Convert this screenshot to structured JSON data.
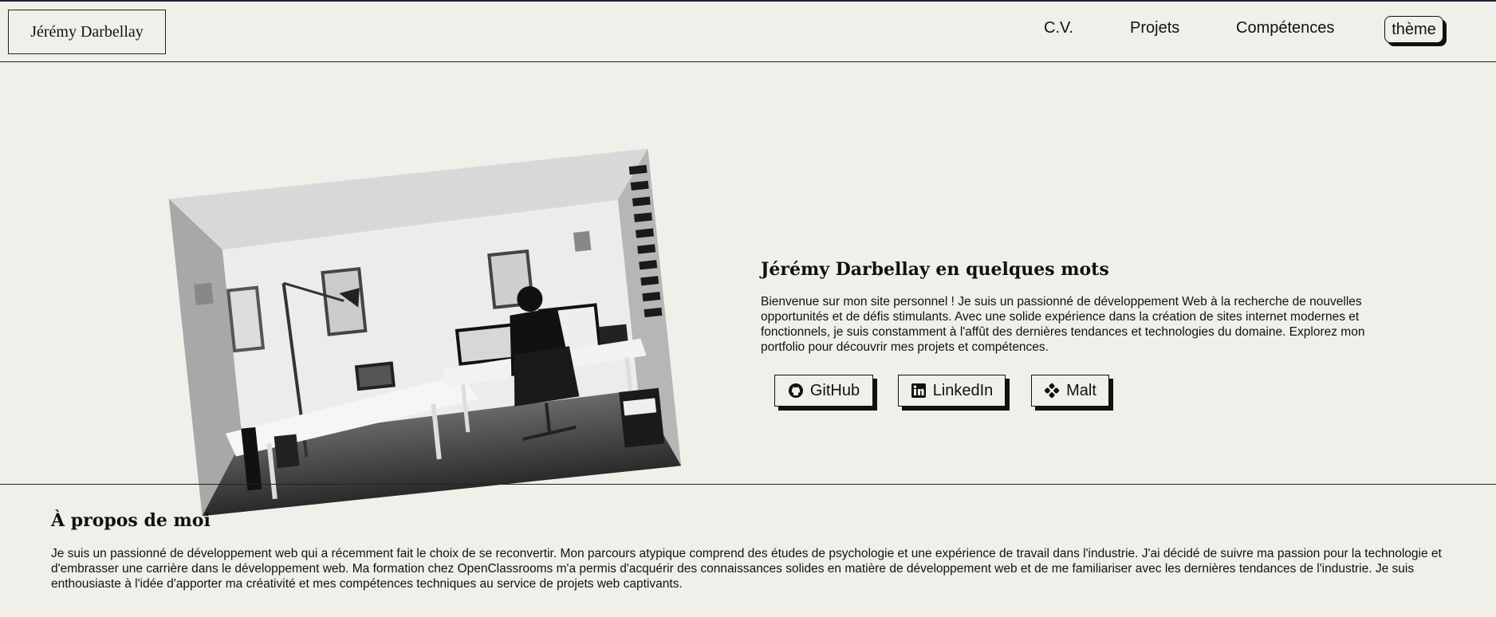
{
  "header": {
    "brand": "Jérémy Darbellay",
    "nav": [
      "C.V.",
      "Projets",
      "Compétences"
    ],
    "theme_label": "thème"
  },
  "hero": {
    "title": "Jérémy Darbellay en quelques mots",
    "text": "Bienvenue sur mon site personnel ! Je suis un passionné de développement Web à la recherche de nouvelles opportunités et de défis stimulants. Avec une solide expérience dans la création de sites internet modernes et fonctionnels, je suis constamment à l'affût des dernières tendances et technologies du domaine. Explorez mon portfolio pour découvrir mes projets et compétences.",
    "links": [
      {
        "label": "GitHub",
        "icon": "github-icon"
      },
      {
        "label": "LinkedIn",
        "icon": "linkedin-icon"
      },
      {
        "label": "Malt",
        "icon": "malt-icon"
      }
    ]
  },
  "about": {
    "title": "À propos de moi",
    "text": "Je suis un passionné de développement web qui a récemment fait le choix de se reconvertir. Mon parcours atypique comprend des études de psychologie et une expérience de travail dans l'industrie. J'ai décidé de suivre ma passion pour la technologie et d'embrasser une carrière dans le développement web. Ma formation chez OpenClassrooms m'a permis d'acquérir des connaissances solides en matière de développement web et de me familiariser avec les dernières tendances de l'industrie. Je suis enthousiaste à l'idée d'apporter ma créativité et mes compétences techniques au service de projets web captivants."
  },
  "colors": {
    "background": "#f1efe9",
    "ink": "#111111"
  }
}
